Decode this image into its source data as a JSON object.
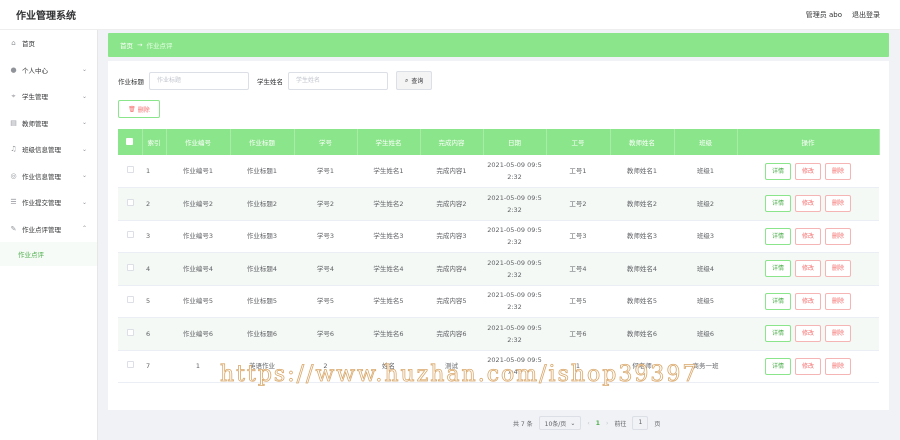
{
  "app": {
    "title": "作业管理系统"
  },
  "header": {
    "user_label": "管理员 abo",
    "logout_label": "退出登录"
  },
  "sidebar": {
    "items": [
      {
        "icon": "home-icon",
        "label": "首页",
        "has_children": false
      },
      {
        "icon": "user-icon",
        "label": "个人中心",
        "has_children": true
      },
      {
        "icon": "student-icon",
        "label": "学生管理",
        "has_children": true
      },
      {
        "icon": "teacher-icon",
        "label": "教师管理",
        "has_children": true
      },
      {
        "icon": "class-icon",
        "label": "班级信息管理",
        "has_children": true
      },
      {
        "icon": "homework-icon",
        "label": "作业信息管理",
        "has_children": true
      },
      {
        "icon": "submit-icon",
        "label": "作业提交管理",
        "has_children": true
      },
      {
        "icon": "review-icon",
        "label": "作业点评管理",
        "has_children": true,
        "expanded": true
      }
    ],
    "submenu": {
      "label": "作业点评"
    }
  },
  "breadcrumb": {
    "home": "首页",
    "separator": "→",
    "current": "作业点评"
  },
  "search": {
    "title_label": "作业标题",
    "title_placeholder": "作业标题",
    "student_label": "学生姓名",
    "student_placeholder": "学生姓名",
    "button_label": "查询"
  },
  "toolbar": {
    "delete_label": "删除"
  },
  "table": {
    "columns": [
      "索引",
      "作业编号",
      "作业标题",
      "学号",
      "学生姓名",
      "完成内容",
      "日期",
      "工号",
      "教师姓名",
      "班级",
      "操作"
    ],
    "actions": {
      "detail": "详情",
      "edit": "修改",
      "delete": "删除"
    },
    "rows": [
      {
        "idx": "1",
        "no": "作业编号1",
        "title": "作业标题1",
        "sid": "学号1",
        "sname": "学生姓名1",
        "content": "完成内容1",
        "date1": "2021-05-09 09:5",
        "date2": "2:32",
        "wid": "工号1",
        "tname": "教师姓名1",
        "cls": "班级1"
      },
      {
        "idx": "2",
        "no": "作业编号2",
        "title": "作业标题2",
        "sid": "学号2",
        "sname": "学生姓名2",
        "content": "完成内容2",
        "date1": "2021-05-09 09:5",
        "date2": "2:32",
        "wid": "工号2",
        "tname": "教师姓名2",
        "cls": "班级2"
      },
      {
        "idx": "3",
        "no": "作业编号3",
        "title": "作业标题3",
        "sid": "学号3",
        "sname": "学生姓名3",
        "content": "完成内容3",
        "date1": "2021-05-09 09:5",
        "date2": "2:32",
        "wid": "工号3",
        "tname": "教师姓名3",
        "cls": "班级3"
      },
      {
        "idx": "4",
        "no": "作业编号4",
        "title": "作业标题4",
        "sid": "学号4",
        "sname": "学生姓名4",
        "content": "完成内容4",
        "date1": "2021-05-09 09:5",
        "date2": "2:32",
        "wid": "工号4",
        "tname": "教师姓名4",
        "cls": "班级4"
      },
      {
        "idx": "5",
        "no": "作业编号5",
        "title": "作业标题5",
        "sid": "学号5",
        "sname": "学生姓名5",
        "content": "完成内容5",
        "date1": "2021-05-09 09:5",
        "date2": "2:32",
        "wid": "工号5",
        "tname": "教师姓名5",
        "cls": "班级5"
      },
      {
        "idx": "6",
        "no": "作业编号6",
        "title": "作业标题6",
        "sid": "学号6",
        "sname": "学生姓名6",
        "content": "完成内容6",
        "date1": "2021-05-09 09:5",
        "date2": "2:32",
        "wid": "工号6",
        "tname": "教师姓名6",
        "cls": "班级6"
      },
      {
        "idx": "7",
        "no": "1",
        "title": "英语作业",
        "sid": "2",
        "sname": "姓名",
        "content": "测试",
        "date1": "2021-05-09 09:5",
        "date2": "7:41",
        "wid": "1",
        "tname": "何老师",
        "cls": "商务一班"
      }
    ]
  },
  "pagination": {
    "total": "共 7 条",
    "page_size": "10条/页",
    "prev": "‹",
    "current": "1",
    "next": "›",
    "goto_label": "前往",
    "goto_value": "1",
    "goto_suffix": "页"
  },
  "watermark": {
    "text": "https://www.huzhan.com/ishop39397"
  },
  "colors": {
    "accent": "#8be58b",
    "danger": "#f56c6c"
  }
}
